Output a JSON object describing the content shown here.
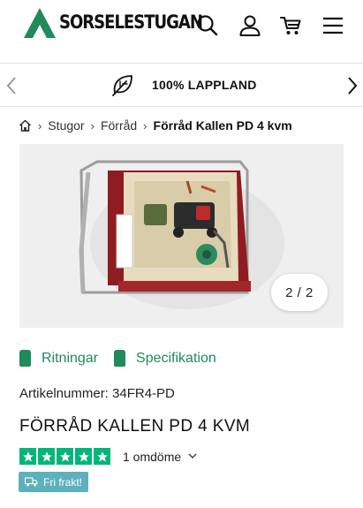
{
  "brand": {
    "name": "SORSELESTUGAN",
    "accent": "#1f8a5a"
  },
  "header": {
    "icons": [
      "search-icon",
      "user-icon",
      "cart-icon",
      "menu-icon"
    ]
  },
  "usp": {
    "text": "100% LAPPLAND",
    "icon": "leaf-icon"
  },
  "breadcrumb": {
    "items": [
      "Stugor",
      "Förråd"
    ],
    "current": "Förråd Kallen PD 4 kvm"
  },
  "gallery": {
    "pager": "2 / 2"
  },
  "tabs": [
    {
      "label": "Ritningar"
    },
    {
      "label": "Specifikation"
    }
  ],
  "product": {
    "artnr": "Artikelnummer: 34FR4-PD",
    "title": "FÖRRÅD KALLEN PD 4 KVM",
    "stars": 5,
    "reviews": "1 omdöme",
    "badge": "Fri frakt!"
  },
  "colors": {
    "stars": "#00b67a",
    "badge": "#5cb1bc",
    "link": "#1f8a5a"
  }
}
